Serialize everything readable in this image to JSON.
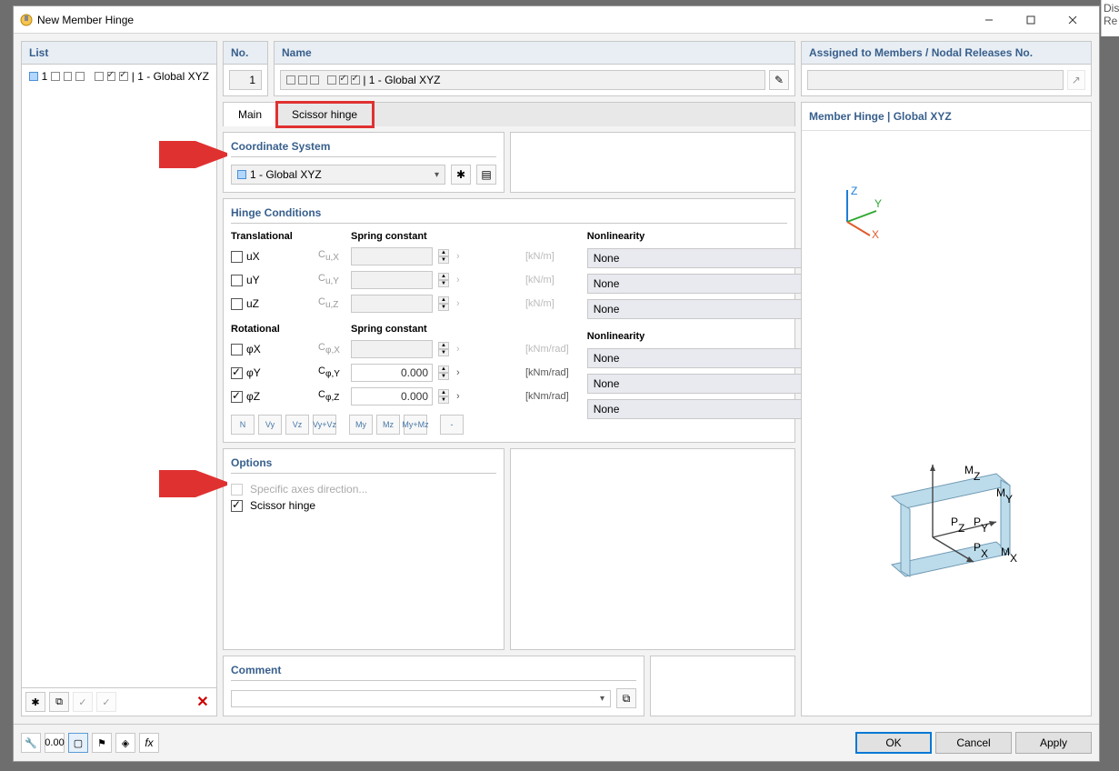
{
  "window": {
    "title": "New Member Hinge"
  },
  "list": {
    "header": "List",
    "item_no": "1",
    "item_suffix": " | 1 - Global XYZ"
  },
  "no": {
    "header": "No.",
    "value": "1"
  },
  "name": {
    "header": "Name",
    "suffix": " | 1 - Global XYZ"
  },
  "assigned": {
    "header": "Assigned to Members / Nodal Releases No."
  },
  "tabs": {
    "main": "Main",
    "scissor": "Scissor hinge"
  },
  "coord": {
    "title": "Coordinate System",
    "value": "1 - Global XYZ"
  },
  "hinge": {
    "title": "Hinge Conditions",
    "trans_head": "Translational",
    "spring_head": "Spring constant",
    "nonlin_head": "Nonlinearity",
    "rot_head": "Rotational",
    "ux": "uX",
    "uy": "uY",
    "uz": "uZ",
    "phix": "φX",
    "phiy": "φY",
    "phiz": "φZ",
    "cux": "Cu,X",
    "cuy": "Cu,Y",
    "cuz": "Cu,Z",
    "cpx": "Cφ,X",
    "cpy": "Cφ,Y",
    "cpz": "Cφ,Z",
    "val_py": "0.000",
    "val_pz": "0.000",
    "unit_kn": "[kN/m]",
    "unit_knm": "[kNm/rad]",
    "none": "None",
    "btns": {
      "n": "N",
      "vy": "Vy",
      "vz": "Vz",
      "vyvz": "Vy+Vz",
      "my": "My",
      "mz": "Mz",
      "mymz": "My+Mz",
      "minus": "-"
    }
  },
  "options": {
    "title": "Options",
    "specific": "Specific axes direction...",
    "scissor": "Scissor hinge"
  },
  "preview": {
    "title": "Member Hinge | Global XYZ"
  },
  "comment": {
    "title": "Comment"
  },
  "footer": {
    "ok": "OK",
    "cancel": "Cancel",
    "apply": "Apply"
  },
  "strip": {
    "l1": "Dis",
    "l2": "Re"
  }
}
